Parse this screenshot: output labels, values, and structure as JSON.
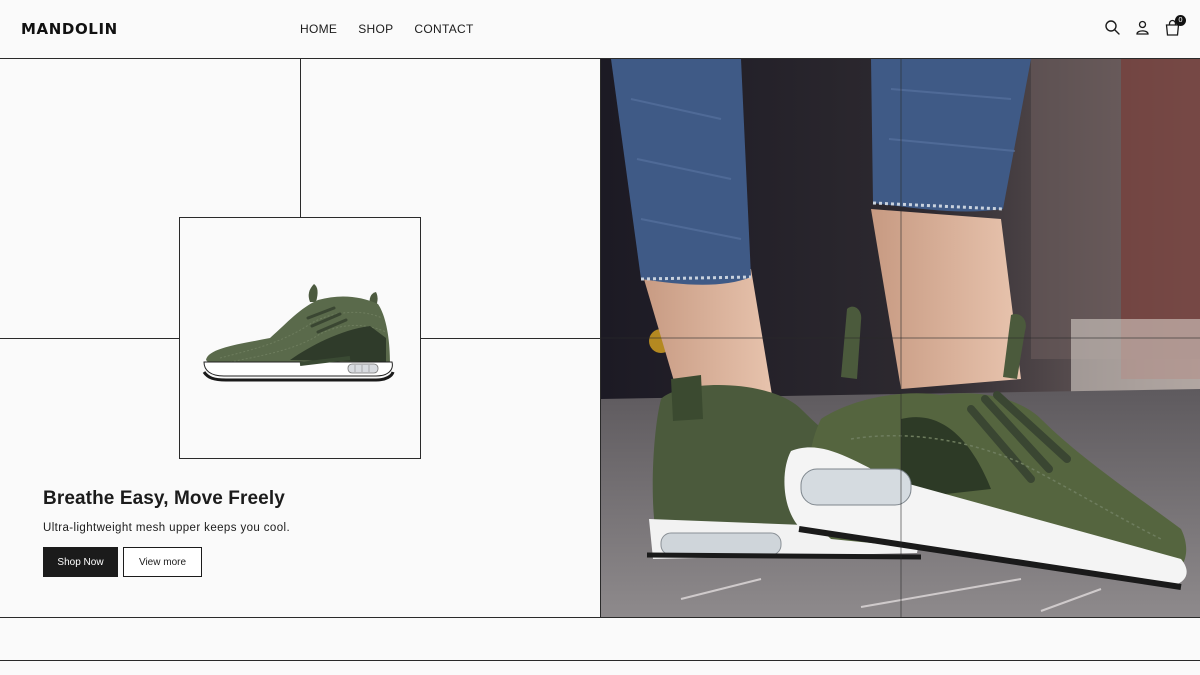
{
  "brand": {
    "logo_text": "MANDOLIN"
  },
  "nav": {
    "items": [
      {
        "label": "HOME"
      },
      {
        "label": "SHOP"
      },
      {
        "label": "CONTACT"
      }
    ]
  },
  "header_icons": {
    "search_icon": "search-icon",
    "account_icon": "user-icon",
    "cart_icon": "shopping-bag-icon",
    "cart_count": "0"
  },
  "hero": {
    "headline": "Breathe Easy, Move Freely",
    "subline": "Ultra-lightweight mesh upper keeps you cool.",
    "primary_button": "Shop Now",
    "secondary_button": "View more"
  },
  "colors": {
    "background": "#fafafa",
    "ink": "#1b1b1b",
    "shoe_green": "#4a5a3c",
    "denim": "#3f5a86"
  }
}
